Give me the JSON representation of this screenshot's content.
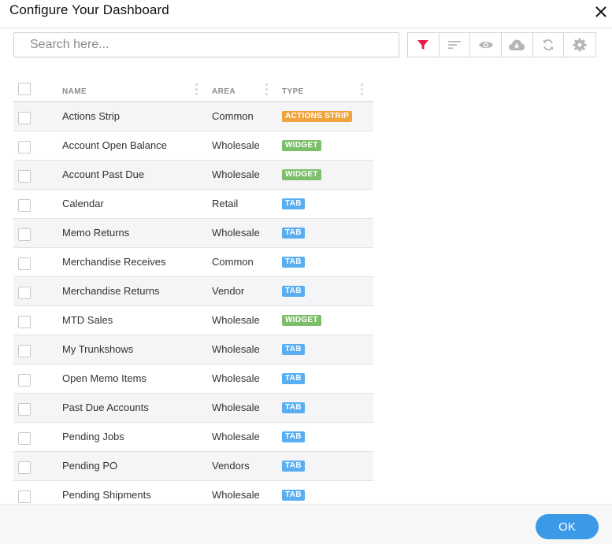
{
  "dialog": {
    "title": "Configure Your Dashboard"
  },
  "search": {
    "placeholder": "Search here...",
    "value": ""
  },
  "toolbar": {
    "icons": [
      "filter-icon",
      "sort-icon",
      "eye-icon",
      "cloud-download-icon",
      "refresh-icon",
      "gear-icon"
    ],
    "active_color": "#e8174a",
    "inactive_color": "#b5b5b5"
  },
  "table": {
    "headers": {
      "name": "NAME",
      "area": "AREA",
      "type": "TYPE"
    },
    "rows": [
      {
        "name": "Actions Strip",
        "area": "Common",
        "type": "ACTIONS STRIP",
        "kind": "actions"
      },
      {
        "name": "Account Open Balance",
        "area": "Wholesale",
        "type": "WIDGET",
        "kind": "widget"
      },
      {
        "name": "Account Past Due",
        "area": "Wholesale",
        "type": "WIDGET",
        "kind": "widget"
      },
      {
        "name": "Calendar",
        "area": "Retail",
        "type": "TAB",
        "kind": "tab"
      },
      {
        "name": "Memo Returns",
        "area": "Wholesale",
        "type": "TAB",
        "kind": "tab"
      },
      {
        "name": "Merchandise Receives",
        "area": "Common",
        "type": "TAB",
        "kind": "tab"
      },
      {
        "name": "Merchandise Returns",
        "area": "Vendor",
        "type": "TAB",
        "kind": "tab"
      },
      {
        "name": "MTD Sales",
        "area": "Wholesale",
        "type": "WIDGET",
        "kind": "widget"
      },
      {
        "name": "My Trunkshows",
        "area": "Wholesale",
        "type": "TAB",
        "kind": "tab"
      },
      {
        "name": "Open Memo Items",
        "area": "Wholesale",
        "type": "TAB",
        "kind": "tab"
      },
      {
        "name": "Past Due Accounts",
        "area": "Wholesale",
        "type": "TAB",
        "kind": "tab"
      },
      {
        "name": "Pending Jobs",
        "area": "Wholesale",
        "type": "TAB",
        "kind": "tab"
      },
      {
        "name": "Pending PO",
        "area": "Vendors",
        "type": "TAB",
        "kind": "tab"
      },
      {
        "name": "Pending Shipments",
        "area": "Wholesale",
        "type": "TAB",
        "kind": "tab"
      }
    ]
  },
  "badge_colors": {
    "actions": "#f0a43c",
    "widget": "#7cbf68",
    "tab": "#58aef0"
  },
  "footer": {
    "ok_label": "OK"
  },
  "colors": {
    "accent": "#3b9ae8",
    "row_alt": "#f5f5f8"
  }
}
